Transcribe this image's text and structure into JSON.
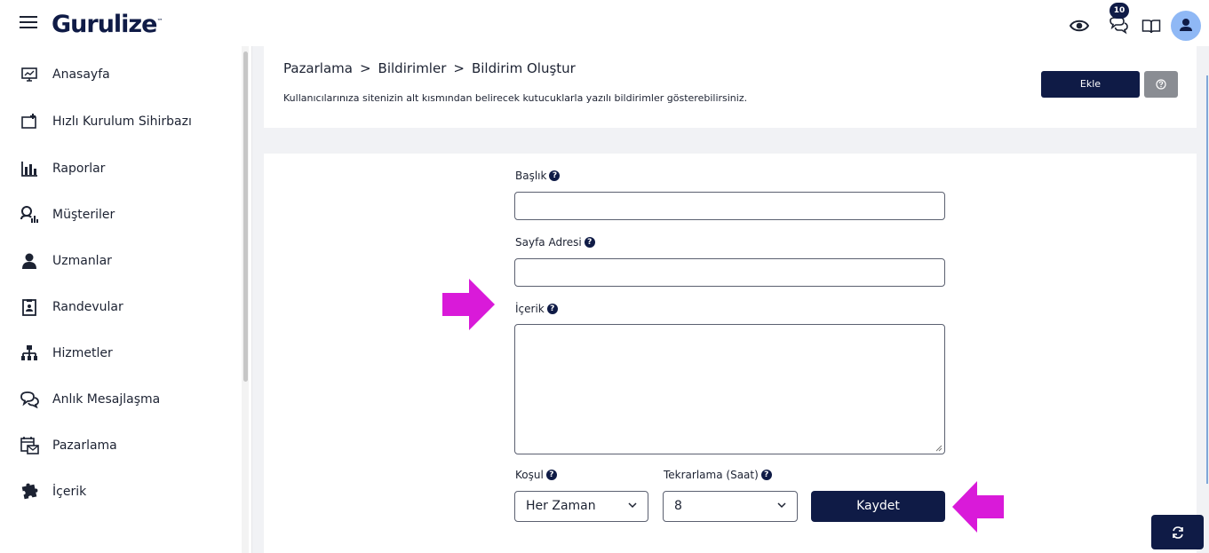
{
  "header": {
    "logo": "Gurulize",
    "logo_tm": "™",
    "notification_count": "10"
  },
  "sidebar": {
    "items": [
      {
        "label": "Anasayfa",
        "icon": "dashboard-icon"
      },
      {
        "label": "Hızlı Kurulum Sihirbazı",
        "icon": "setup-wizard-icon"
      },
      {
        "label": "Raporlar",
        "icon": "bar-chart-icon"
      },
      {
        "label": "Müşteriler",
        "icon": "customers-icon"
      },
      {
        "label": "Uzmanlar",
        "icon": "user-icon"
      },
      {
        "label": "Randevular",
        "icon": "appointment-icon"
      },
      {
        "label": "Hizmetler",
        "icon": "sitemap-icon"
      },
      {
        "label": "Anlık Mesajlaşma",
        "icon": "chat-bubbles-icon"
      },
      {
        "label": "Pazarlama",
        "icon": "calendar-mail-icon"
      },
      {
        "label": "İçerik",
        "icon": "puzzle-icon"
      }
    ]
  },
  "page": {
    "breadcrumb": [
      "Pazarlama",
      "Bildirimler",
      "Bildirim Oluştur"
    ],
    "breadcrumb_sep": ">",
    "subtitle": "Kullanıcılarınıza sitenizin alt kısmından belirecek kutucuklarla yazılı bildirimler gösterebilirsiniz.",
    "add_button": "Ekle"
  },
  "form": {
    "title_label": "Başlık",
    "title_value": "",
    "url_label": "Sayfa Adresi",
    "url_value": "",
    "content_label": "İçerik",
    "content_value": "",
    "condition_label": "Koşul",
    "condition_value": "Her Zaman",
    "repeat_label": "Tekrarlama (Saat)",
    "repeat_value": "8",
    "save_button": "Kaydet"
  },
  "colors": {
    "primary": "#0f1b46",
    "annotation_arrow": "#d91ad9",
    "avatar": "#8fb8f5",
    "help_button": "#8a8d93"
  }
}
